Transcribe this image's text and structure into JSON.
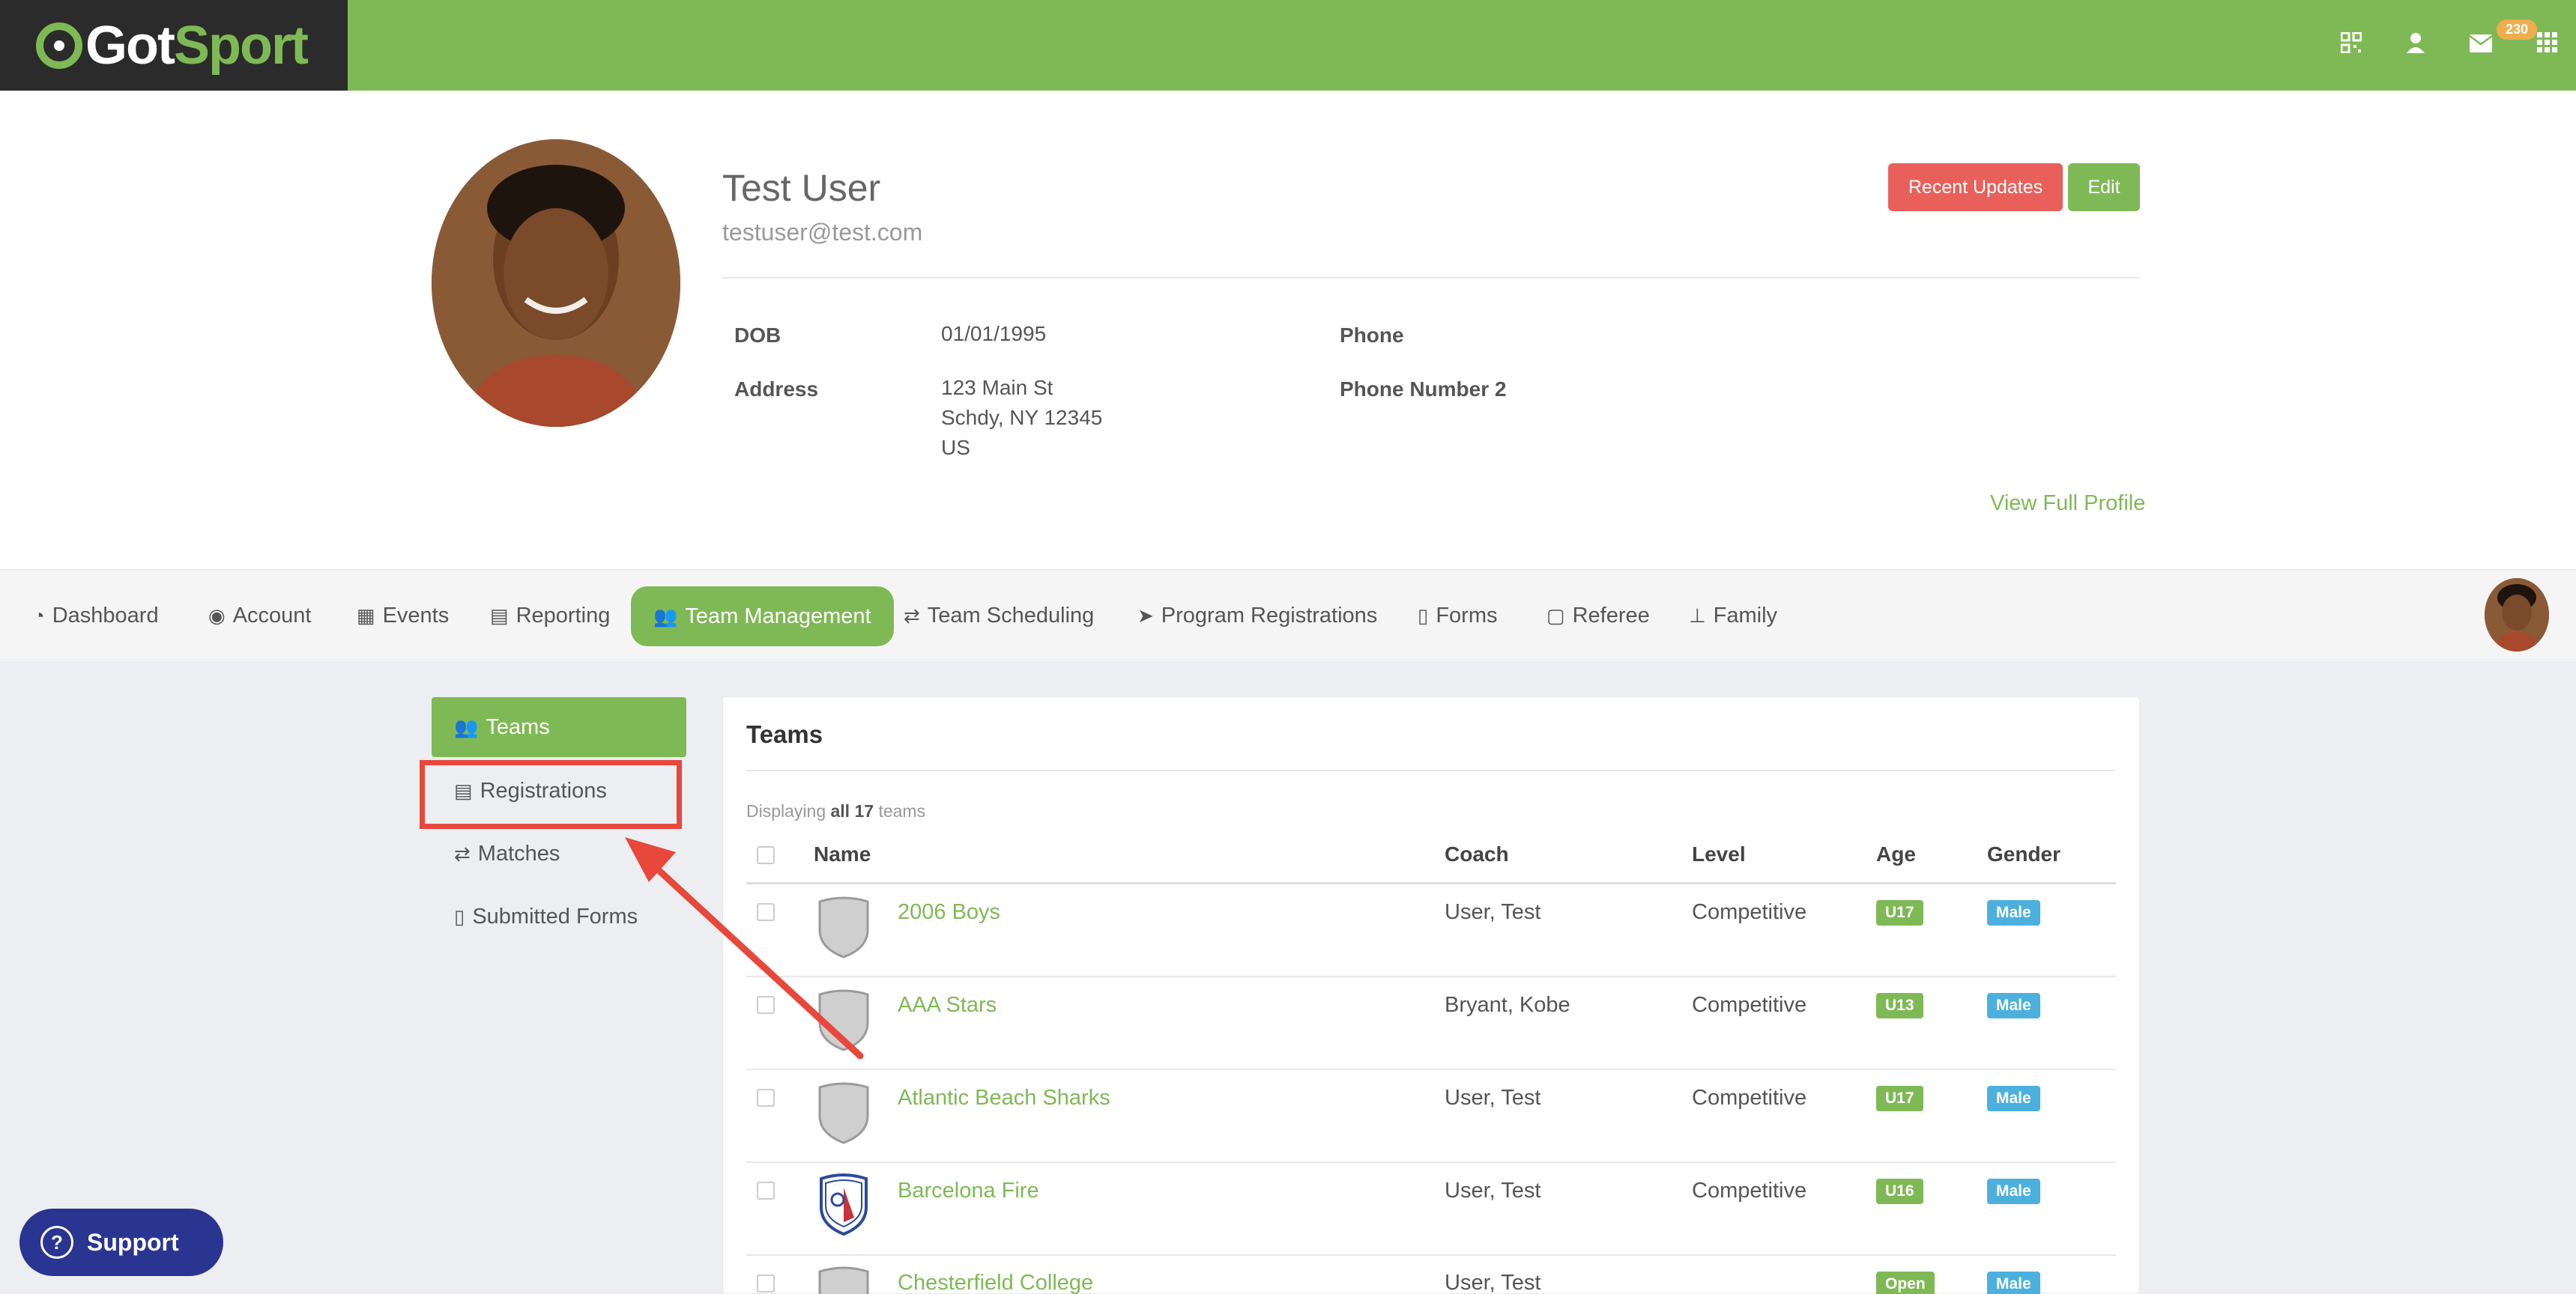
{
  "header": {
    "logo": {
      "got": "Got",
      "sport": "Sport"
    },
    "icons": [
      "qr-code-icon",
      "user-icon",
      "mail-icon",
      "apps-grid-icon"
    ],
    "mail_count": "230"
  },
  "profile": {
    "name": "Test User",
    "email": "testuser@test.com",
    "recent_updates_label": "Recent Updates",
    "edit_label": "Edit",
    "dob_label": "DOB",
    "dob_value": "01/01/1995",
    "address_label": "Address",
    "address_line1": "123 Main St",
    "address_line2": "Schdy, NY 12345",
    "address_line3": "US",
    "phone_label": "Phone",
    "phone2_label": "Phone Number 2",
    "view_full_profile": "View Full Profile"
  },
  "nav": {
    "items": [
      {
        "label": "Dashboard",
        "icon": "dashboard-icon"
      },
      {
        "label": "Account",
        "icon": "user-circle-icon"
      },
      {
        "label": "Events",
        "icon": "calendar-icon"
      },
      {
        "label": "Reporting",
        "icon": "document-icon"
      },
      {
        "label": "Team Management",
        "icon": "users-icon"
      },
      {
        "label": "Team Scheduling",
        "icon": "exchange-icon"
      },
      {
        "label": "Program Registrations",
        "icon": "paper-plane-icon"
      },
      {
        "label": "Forms",
        "icon": "file-icon"
      },
      {
        "label": "Referee",
        "icon": "calendar-blank-icon"
      },
      {
        "label": "Family",
        "icon": "sitemap-icon"
      }
    ],
    "active": "Team Management"
  },
  "sidebar": {
    "items": [
      {
        "label": "Teams",
        "icon": "users-icon"
      },
      {
        "label": "Registrations",
        "icon": "list-icon"
      },
      {
        "label": "Matches",
        "icon": "exchange-icon"
      },
      {
        "label": "Submitted Forms",
        "icon": "file-icon"
      }
    ]
  },
  "teams": {
    "title": "Teams",
    "displaying_prefix": "Displaying",
    "displaying_bold": "all 17",
    "displaying_suffix": "teams",
    "columns": {
      "name": "Name",
      "coach": "Coach",
      "level": "Level",
      "age": "Age",
      "gender": "Gender"
    },
    "rows": [
      {
        "name": "2006 Boys",
        "coach": "User, Test",
        "level": "Competitive",
        "age": "U17",
        "gender": "Male",
        "crest": "shield-icon"
      },
      {
        "name": "AAA Stars",
        "coach": "Bryant, Kobe",
        "level": "Competitive",
        "age": "U13",
        "gender": "Male",
        "crest": "shield-icon"
      },
      {
        "name": "Atlantic Beach Sharks",
        "coach": "User, Test",
        "level": "Competitive",
        "age": "U17",
        "gender": "Male",
        "crest": "shield-icon"
      },
      {
        "name": "Barcelona Fire",
        "coach": "User, Test",
        "level": "Competitive",
        "age": "U16",
        "gender": "Male",
        "crest": "club-crest-icon"
      },
      {
        "name": "Chesterfield College",
        "coach": "User, Test",
        "level": "",
        "age": "Open",
        "gender": "Male",
        "crest": "shield-icon"
      }
    ]
  },
  "support": {
    "label": "Support"
  },
  "colors": {
    "brand_green": "#7fb955",
    "red": "#e9605a",
    "highlight": "#e8483b",
    "info_blue": "#4cb0de",
    "support_navy": "#2a3491"
  }
}
